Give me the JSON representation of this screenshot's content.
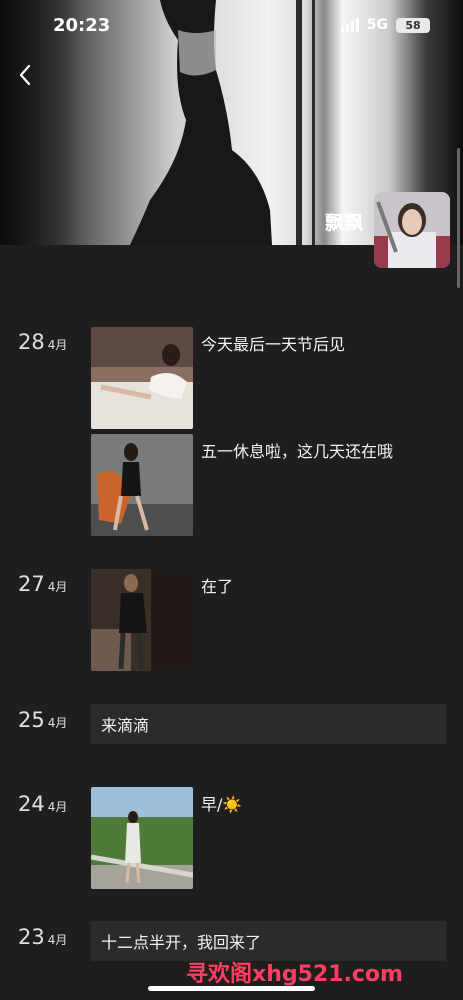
{
  "status_bar": {
    "time": "20:23",
    "network": "5G",
    "battery": "58"
  },
  "profile": {
    "name": "飘飘"
  },
  "entries": [
    {
      "day": "28",
      "month": "4月",
      "posts": [
        {
          "caption": "今天最后一天节后见"
        },
        {
          "caption": "五一休息啦，这几天还在哦"
        }
      ]
    },
    {
      "day": "27",
      "month": "4月",
      "posts": [
        {
          "caption": "在了"
        }
      ]
    },
    {
      "day": "25",
      "month": "4月",
      "text": "来滴滴"
    },
    {
      "day": "24",
      "month": "4月",
      "posts": [
        {
          "caption": "早/☀️"
        }
      ]
    },
    {
      "day": "23",
      "month": "4月",
      "text": "十二点半开，我回来了"
    }
  ],
  "watermark": "寻欢阁xhg521.com",
  "colors": {
    "background": "#1e1e1e",
    "text_card": "#2b2b2b",
    "watermark": "#ff3e62"
  }
}
